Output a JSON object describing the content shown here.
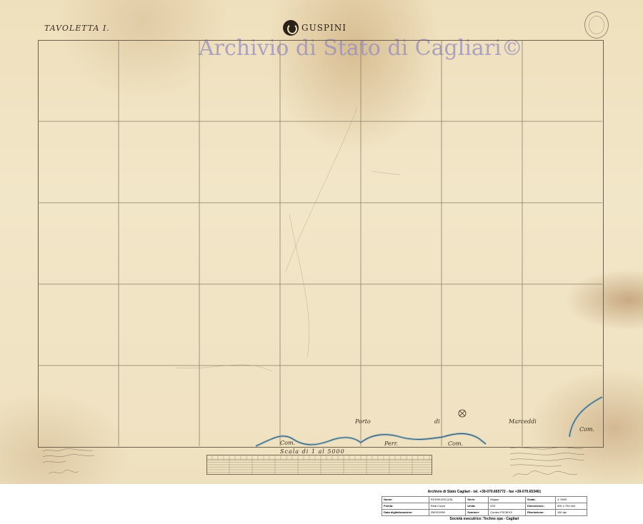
{
  "sheet": {
    "tavoletta_label": "TAVOLETTA I.",
    "title": "GUSPINI",
    "watermark": "Archivio di Stato di Cagliari©",
    "scale_caption": "Scala di 1 al 5000",
    "place_labels": [
      {
        "text": "Porto",
        "name": "porto-label"
      },
      {
        "text": "di",
        "name": "di-label"
      },
      {
        "text": "Marceddi",
        "name": "marceddi-label"
      },
      {
        "text": "Com.",
        "name": "com-label-right"
      },
      {
        "text": "Com.",
        "name": "com-label-left"
      },
      {
        "text": "Perr.",
        "name": "perr-label"
      },
      {
        "text": "Com.",
        "name": "com-label-center"
      }
    ]
  },
  "metadata": {
    "header": "Archivio di Stato Cagliari - tel. +39-070.665772 - fax +39-070.653461",
    "rows": [
      [
        "Nome:",
        "RCD90-003  (1/5)",
        "Serie:",
        "Mappe",
        "Scala:",
        "1: 5000"
      ],
      [
        "Fondo:",
        "Real Corpo",
        "Unità:",
        "003",
        "Dimensione:",
        "590 x 754 mm"
      ],
      [
        "Data digitalizzazione:",
        "25/03/1999",
        "Scanner:",
        "Contex FSC8010",
        "Risoluzione:",
        "150 dpi"
      ]
    ],
    "footer": "Società esecutrice: Techno spa - Cagliari"
  }
}
